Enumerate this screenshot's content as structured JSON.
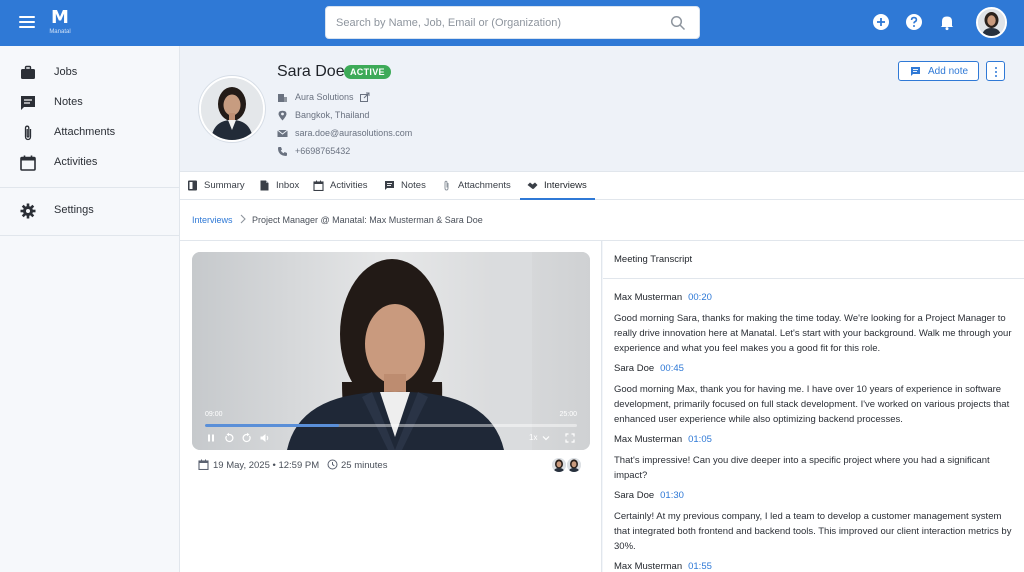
{
  "topbar": {
    "logo_mark": "M",
    "logo_text": "Manatal",
    "search_placeholder": "Search by Name, Job, Email or (Organization)"
  },
  "sidebar": {
    "items": [
      {
        "label": "Jobs",
        "icon": "briefcase-icon"
      },
      {
        "label": "Notes",
        "icon": "notes-icon"
      },
      {
        "label": "Attachments",
        "icon": "paperclip-icon"
      },
      {
        "label": "Activities",
        "icon": "calendar-icon"
      }
    ],
    "settings_label": "Settings"
  },
  "candidate": {
    "name": "Sara Doe",
    "status": "ACTIVE",
    "company": "Aura Solutions",
    "location": "Bangkok, Thailand",
    "email": "sara.doe@aurasolutions.com",
    "phone": "+6698765432"
  },
  "actions": {
    "add_note": "Add note"
  },
  "tabs": [
    {
      "label": "Summary",
      "icon": "summary-icon"
    },
    {
      "label": "Inbox",
      "icon": "inbox-icon"
    },
    {
      "label": "Activities",
      "icon": "calendar-icon"
    },
    {
      "label": "Notes",
      "icon": "notes-icon"
    },
    {
      "label": "Attachments",
      "icon": "paperclip-icon"
    },
    {
      "label": "Interviews",
      "icon": "handshake-icon",
      "active": true
    }
  ],
  "breadcrumb": {
    "root": "Interviews",
    "current": "Project Manager @ Manatal: Max Musterman & Sara Doe"
  },
  "video": {
    "current_time": "09:00",
    "duration": "25:00",
    "progress": 0.36,
    "speed": "1x",
    "date": "19 May, 2025 • 12:59 PM",
    "length": "25 minutes"
  },
  "transcript": {
    "title": "Meeting Transcript",
    "entries": [
      {
        "speaker": "Max Musterman",
        "time": "00:20",
        "text": "Good morning Sara, thanks for making the time today. We're looking for a Project Manager to really drive innovation here at Manatal. Let's start with your background. Walk me through your experience and what you feel makes you a good fit for this role."
      },
      {
        "speaker": "Sara Doe",
        "time": "00:45",
        "text": "Good morning Max, thank you for having me. I have over 10 years of experience in software development, primarily focused on full stack development. I've worked on various projects that enhanced user experience while also optimizing backend processes."
      },
      {
        "speaker": "Max Musterman",
        "time": "01:05",
        "text": "That's impressive! Can you dive deeper into a specific project where you had a significant impact?"
      },
      {
        "speaker": "Sara Doe",
        "time": "01:30",
        "text": "Certainly! At my previous company, I led a team to develop a customer management system that integrated both frontend and backend tools. This improved our client interaction metrics by 30%."
      },
      {
        "speaker": "Max Musterman",
        "time": "01:55",
        "text": ""
      }
    ]
  },
  "colors": {
    "brand": "#2f79d6",
    "active_badge": "#3daa58"
  }
}
